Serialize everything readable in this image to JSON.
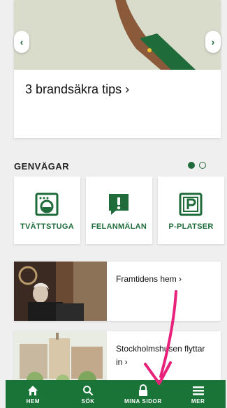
{
  "carousel": {
    "title": "3 brandsäkra tips",
    "arrow_label": "›",
    "prev_glyph": "‹",
    "next_glyph": "›"
  },
  "shortcuts": {
    "heading": "GENVÄGAR",
    "page_index": 1,
    "page_count": 2,
    "tiles": [
      {
        "label": "TVÄTTSTUGA",
        "icon": "washing-machine-icon"
      },
      {
        "label": "FELANMÄLAN",
        "icon": "alert-bubble-icon"
      },
      {
        "label": "P-PLATSER",
        "icon": "parking-icon"
      }
    ]
  },
  "articles": [
    {
      "title": "Framtidens hem ›"
    },
    {
      "title": "Stockholmshusen flyttar in ›"
    }
  ],
  "bottom_nav": {
    "items": [
      {
        "label": "HEM",
        "icon": "home-icon"
      },
      {
        "label": "SÖK",
        "icon": "search-icon"
      },
      {
        "label": "MINA SIDOR",
        "icon": "lock-icon"
      },
      {
        "label": "MER",
        "icon": "menu-icon"
      }
    ]
  },
  "colors": {
    "brand_green": "#1a7337",
    "annotation_pink": "#e8217a"
  }
}
